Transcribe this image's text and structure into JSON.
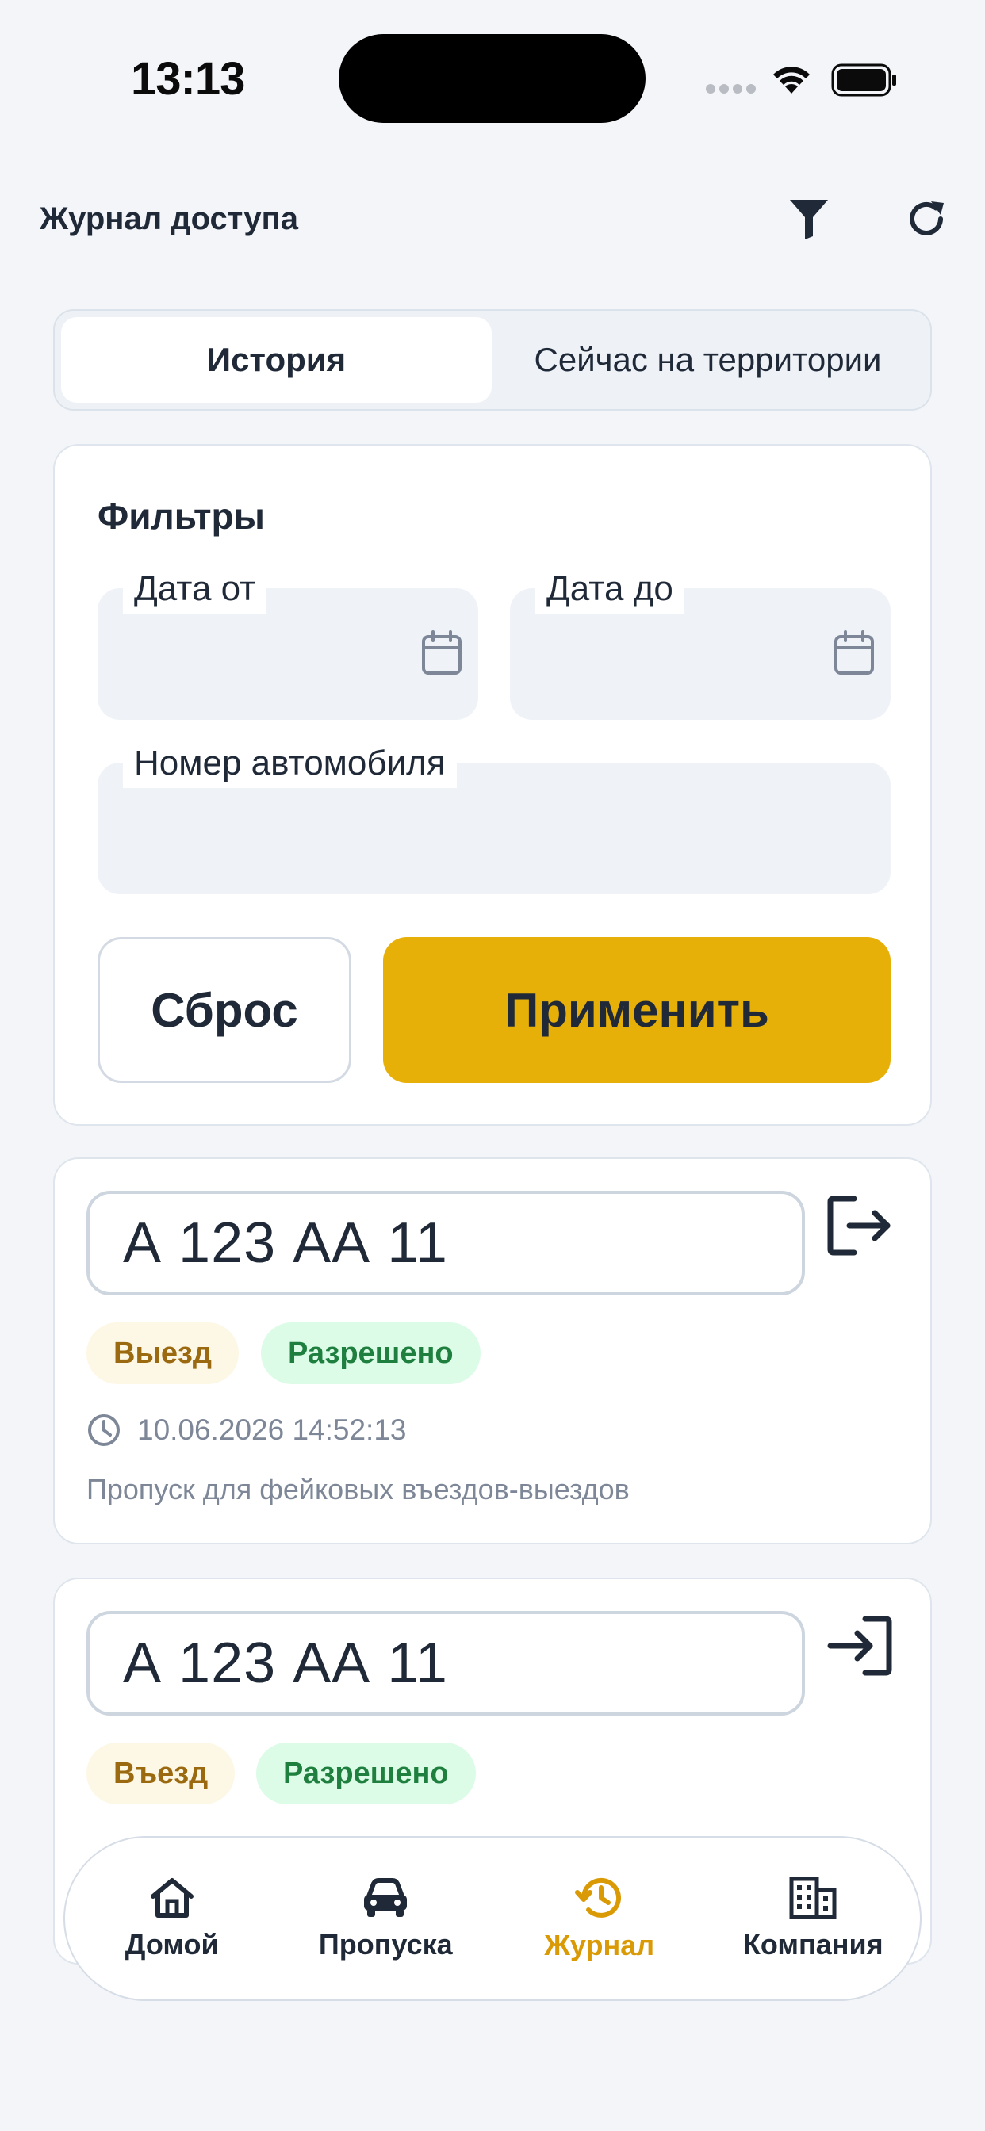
{
  "status_bar": {
    "time": "13:13"
  },
  "header": {
    "title": "Журнал доступа",
    "filter_icon": "filter-icon",
    "refresh_icon": "refresh-icon"
  },
  "tabs": [
    {
      "label": "История",
      "active": true
    },
    {
      "label": "Сейчас на территории",
      "active": false
    }
  ],
  "filters": {
    "title": "Фильтры",
    "date_from": {
      "label": "Дата от",
      "value": ""
    },
    "date_to": {
      "label": "Дата до",
      "value": ""
    },
    "car_number": {
      "label": "Номер автомобиля",
      "value": ""
    },
    "reset_label": "Сброс",
    "apply_label": "Применить"
  },
  "entries": [
    {
      "plate": "А 123 АА 11",
      "direction": "Выезд",
      "direction_icon": "logout-icon",
      "status": "Разрешено",
      "timestamp": "10.06.2026 14:52:13",
      "description": "Пропуск для фейковых въездов-выездов"
    },
    {
      "plate": "А 123 АА 11",
      "direction": "Въезд",
      "direction_icon": "login-icon",
      "status": "Разрешено"
    }
  ],
  "bottom_nav": [
    {
      "label": "Домой",
      "icon": "home-icon",
      "active": false
    },
    {
      "label": "Пропуска",
      "icon": "car-icon",
      "active": false
    },
    {
      "label": "Журнал",
      "icon": "history-icon",
      "active": true
    },
    {
      "label": "Компания",
      "icon": "building-icon",
      "active": false
    }
  ],
  "colors": {
    "accent": "#e7b008",
    "nav_active": "#d99a06",
    "badge_ok_bg": "#dcfce7",
    "badge_ok_text": "#1f7f3f",
    "badge_dir_bg": "#fdf8e5",
    "badge_dir_text": "#9b6a10"
  }
}
